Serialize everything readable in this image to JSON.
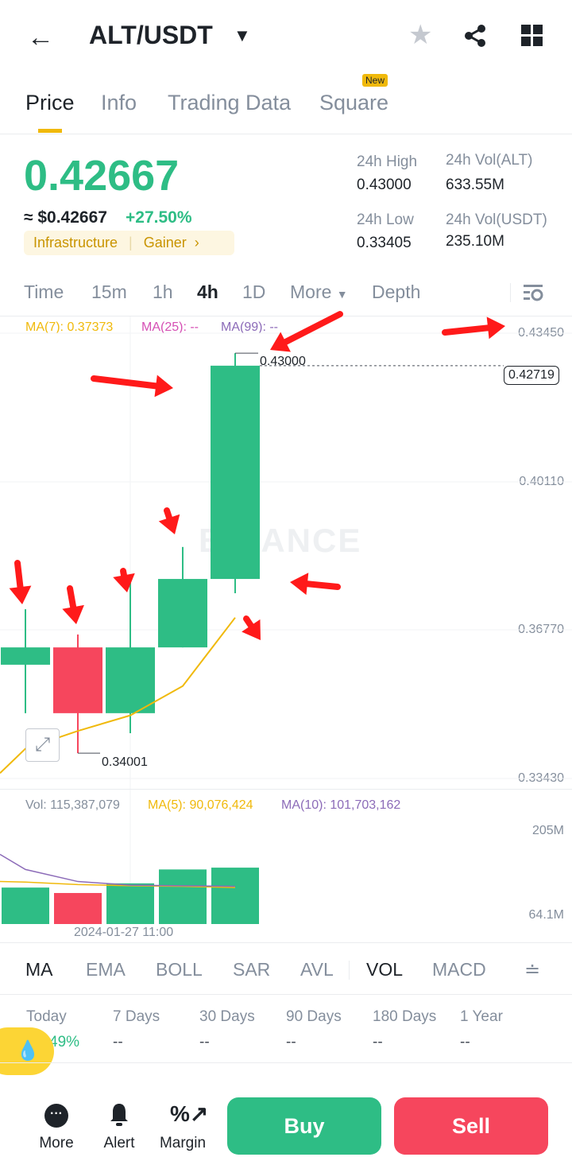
{
  "header": {
    "title": "ALT/USDT"
  },
  "tabs": [
    {
      "label": "Price"
    },
    {
      "label": "Info"
    },
    {
      "label": "Trading Data"
    },
    {
      "label": "Square",
      "badge": "New"
    }
  ],
  "price": {
    "last": "0.42667",
    "usd": "≈ $0.42667",
    "change": "+27.50%",
    "tags": [
      "Infrastructure",
      "Gainer"
    ]
  },
  "stats": {
    "high_label": "24h High",
    "high": "0.43000",
    "low_label": "24h Low",
    "low": "0.33405",
    "vol_alt_label": "24h Vol(ALT)",
    "vol_alt": "633.55M",
    "vol_usdt_label": "24h Vol(USDT)",
    "vol_usdt": "235.10M"
  },
  "timeframes": [
    "Time",
    "15m",
    "1h",
    "4h",
    "1D",
    "More",
    "Depth"
  ],
  "active_timeframe": "4h",
  "colors": {
    "up": "#2ebd85",
    "down": "#f6465d",
    "ma7": "#f0b90b",
    "ma25": "#d54fb4",
    "ma99": "#8c6bb8",
    "annotation": "#ff1a1a"
  },
  "chart_data": {
    "type": "candlestick",
    "ma_legend": {
      "ma7": "MA(7): 0.37373",
      "ma25": "MA(25): --",
      "ma99": "MA(99): --"
    },
    "price_ticks": [
      "0.43450",
      "0.40110",
      "0.36770",
      "0.33430"
    ],
    "ylim": [
      0.3343,
      0.4345
    ],
    "current_price_label": "0.42719",
    "high_label": "0.43000",
    "low_label": "0.34001",
    "candles": [
      {
        "open": 0.3599,
        "close": 0.3638,
        "high": 0.3724,
        "low": 0.349
      },
      {
        "open": 0.3638,
        "close": 0.349,
        "high": 0.3667,
        "low": 0.34001
      },
      {
        "open": 0.349,
        "close": 0.3638,
        "high": 0.3794,
        "low": 0.3445
      },
      {
        "open": 0.3638,
        "close": 0.3792,
        "high": 0.3864,
        "low": 0.3638
      },
      {
        "open": 0.3792,
        "close": 0.42719,
        "high": 0.43,
        "low": 0.376
      }
    ],
    "ma7": [
      0.341,
      0.345,
      0.3485,
      0.3551,
      0.3705
    ],
    "volume_legend": {
      "vol": "Vol: 115,387,079",
      "ma5": "MA(5): 90,076,424",
      "ma10": "MA(10): 101,703,162"
    },
    "volume_ticks": [
      "205M",
      "64.1M"
    ],
    "volume_ylim": [
      64.1,
      205
    ],
    "volumes": [
      110,
      101,
      117,
      140,
      143
    ],
    "vol_ma5": [
      119,
      115,
      113,
      112,
      110
    ],
    "vol_ma10": [
      140,
      120,
      114,
      113,
      112
    ],
    "x_label": "2024-01-27 11:00",
    "watermark": "BINANCE"
  },
  "indicators": [
    "MA",
    "EMA",
    "BOLL",
    "SAR",
    "AVL",
    "VOL",
    "MACD"
  ],
  "periods": [
    {
      "label": "Today",
      "value": "49%"
    },
    {
      "label": "7 Days",
      "value": "--"
    },
    {
      "label": "30 Days",
      "value": "--"
    },
    {
      "label": "90 Days",
      "value": "--"
    },
    {
      "label": "180 Days",
      "value": "--"
    },
    {
      "label": "1 Year",
      "value": "--"
    }
  ],
  "bottom": {
    "more": "More",
    "alert": "Alert",
    "margin": "Margin",
    "buy": "Buy",
    "sell": "Sell"
  }
}
